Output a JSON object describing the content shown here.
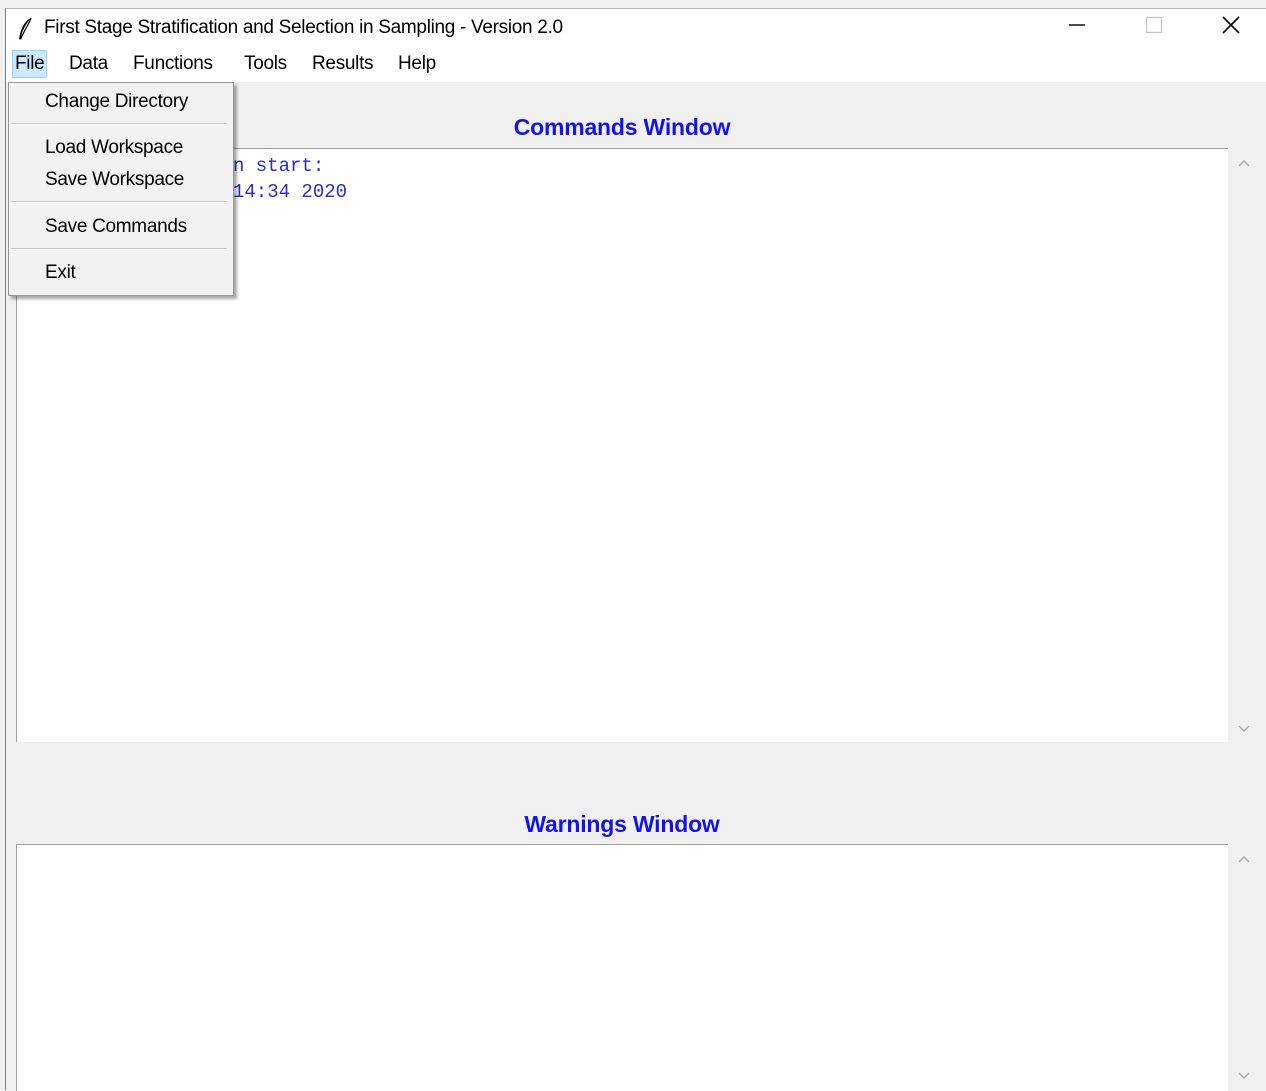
{
  "window": {
    "title": "First Stage Stratification and Selection in Sampling - Version 2.0"
  },
  "menubar": {
    "items": [
      {
        "label": "File"
      },
      {
        "label": "Data"
      },
      {
        "label": "Functions"
      },
      {
        "label": "Tools"
      },
      {
        "label": "Results"
      },
      {
        "label": "Help"
      }
    ]
  },
  "file_menu": {
    "items": [
      {
        "label": "Change Directory"
      },
      {
        "label": "Load Workspace"
      },
      {
        "label": "Save Workspace"
      },
      {
        "label": "Save Commands"
      },
      {
        "label": "Exit"
      }
    ]
  },
  "commands": {
    "title": "Commands Window",
    "lines": [
      "n start:",
      "14:34 2020"
    ]
  },
  "warnings": {
    "title": "Warnings Window"
  },
  "colors": {
    "accent": "#1414e8",
    "console_text": "#2b2bd2",
    "menu_highlight": "#cce8ff"
  },
  "icons": {
    "app": "feather-icon",
    "minimize": "minimize-icon",
    "maximize": "maximize-icon",
    "close": "close-icon",
    "scroll_up": "chevron-up-icon",
    "scroll_down": "chevron-down-icon"
  }
}
